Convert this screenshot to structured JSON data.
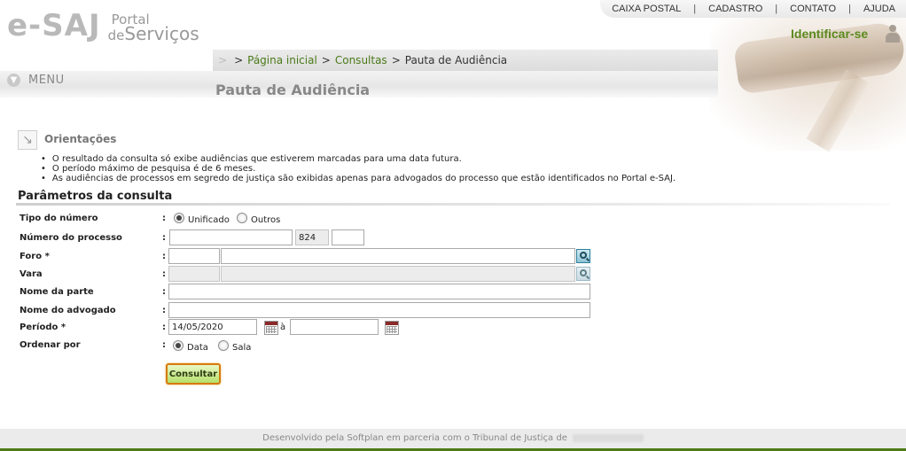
{
  "header": {
    "logo": {
      "esaj": "e-SAJ",
      "portal": "Portal",
      "de": "de",
      "servicos": "Serviços"
    },
    "top_links": [
      "CAIXA POSTAL",
      "CADASTRO",
      "CONTATO",
      "AJUDA"
    ],
    "identificar": "Identificar-se",
    "breadcrumb": {
      "home": "Página inicial",
      "consultas": "Consultas",
      "current": "Pauta de Audiência"
    },
    "menu_label": "MENU",
    "page_title": "Pauta de Audiência"
  },
  "orientacoes": {
    "title": "Orientações",
    "items": [
      "O resultado da consulta só exibe audiências que estiverem marcadas para uma data futura.",
      "O período máximo de pesquisa é de 6 meses.",
      "As audiências de processos em segredo de justiça são exibidas apenas para advogados do processo que estão identificados no Portal e-SAJ."
    ]
  },
  "form": {
    "title": "Parâmetros da consulta",
    "colon": ":",
    "tipo_numero": {
      "label": "Tipo do número",
      "opt1": "Unificado",
      "opt2": "Outros"
    },
    "numero_processo": {
      "label": "Número do processo",
      "value1": "",
      "value2": "824",
      "value3": ""
    },
    "foro": {
      "label": "Foro  *",
      "code": "",
      "name": ""
    },
    "vara": {
      "label": "Vara",
      "code": "",
      "name": ""
    },
    "nome_parte": {
      "label": "Nome da parte",
      "value": ""
    },
    "nome_advogado": {
      "label": "Nome do advogado",
      "value": ""
    },
    "periodo": {
      "label": "Período  *",
      "start": "14/05/2020",
      "separator": "à",
      "end": ""
    },
    "ordenar": {
      "label": "Ordenar por",
      "opt1": "Data",
      "opt2": "Sala"
    },
    "submit": "Consultar"
  },
  "footer": {
    "text": "Desenvolvido pela Softplan em parceria com o Tribunal de Justiça de"
  }
}
